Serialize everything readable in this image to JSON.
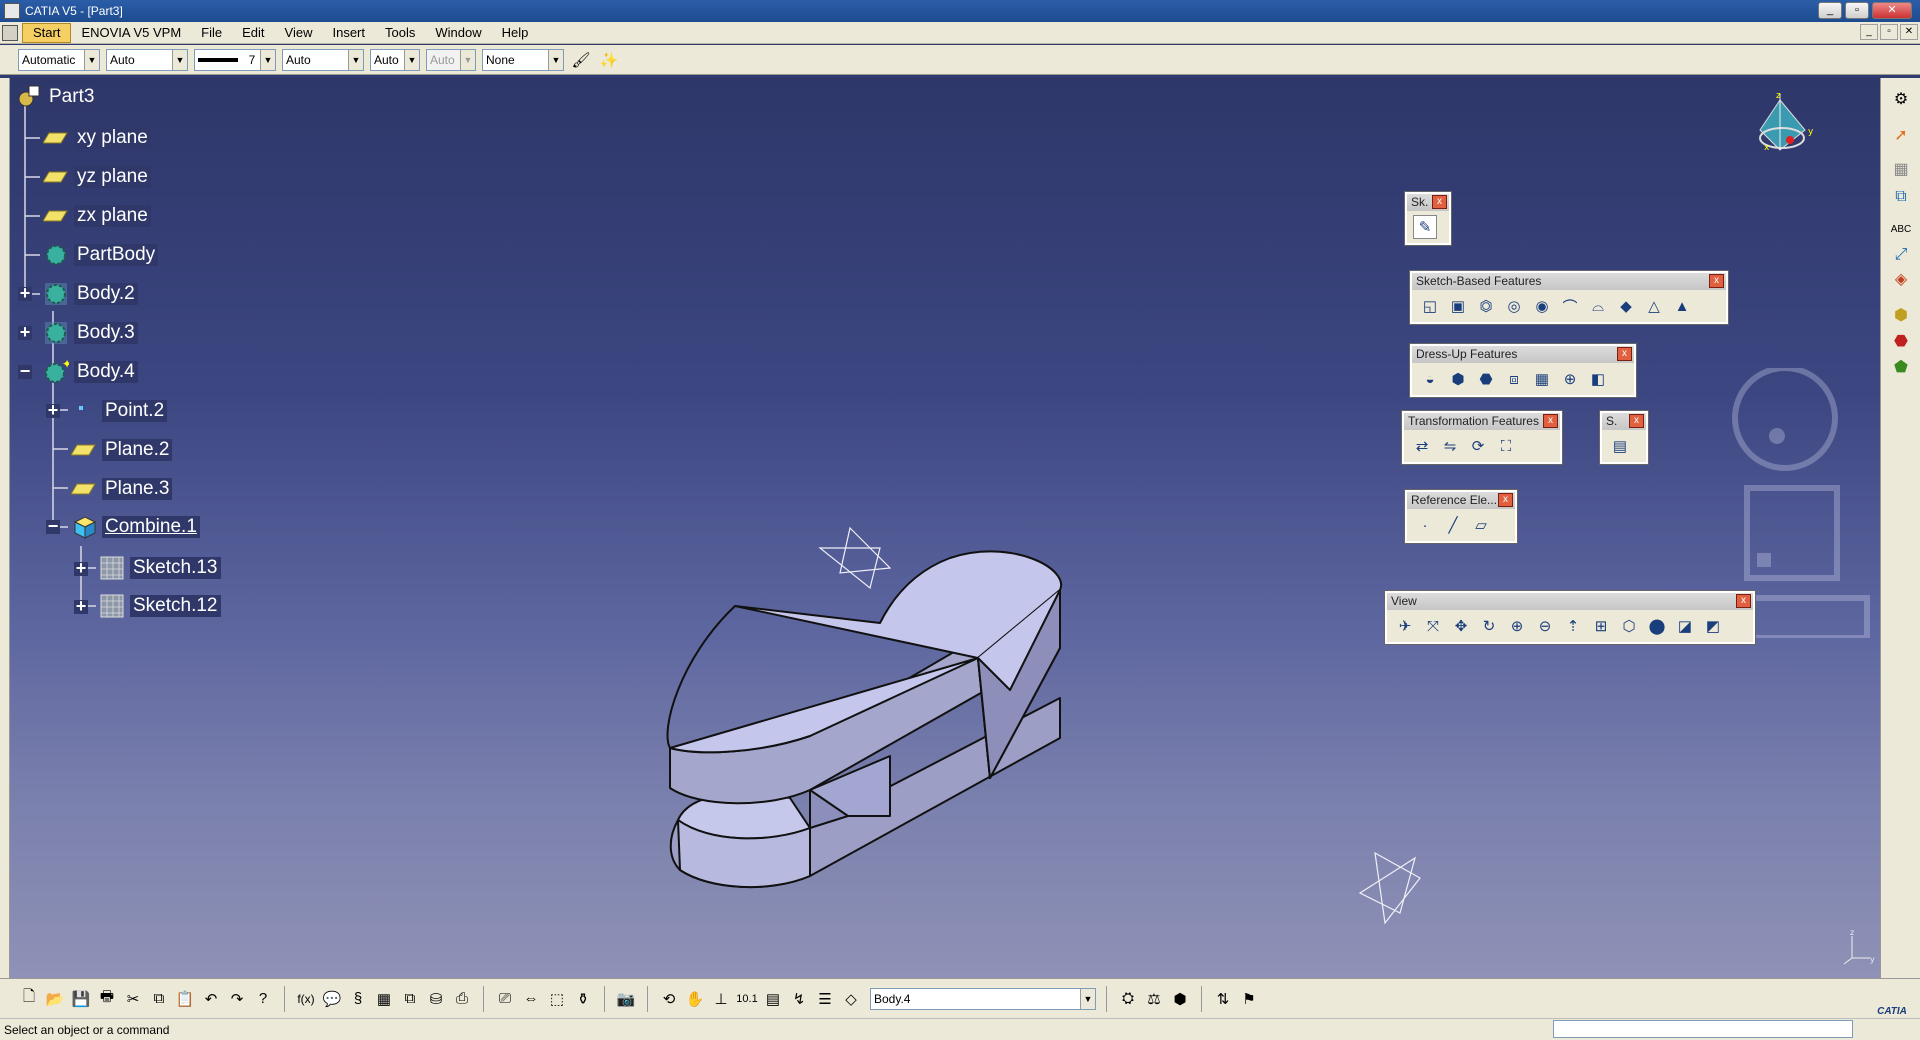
{
  "window": {
    "title": "CATIA V5 - [Part3]"
  },
  "menu": {
    "items": [
      "Start",
      "ENOVIA V5 VPM",
      "File",
      "Edit",
      "View",
      "Insert",
      "Tools",
      "Window",
      "Help"
    ]
  },
  "properties_toolbar": {
    "color": "Automatic",
    "transparency": "Auto",
    "linetype_weight": "7",
    "line_type": "Auto",
    "point_type": "Auto",
    "layer_disabled": "Auto",
    "layer": "None"
  },
  "spec_tree": {
    "root": "Part3",
    "nodes": [
      "xy plane",
      "yz plane",
      "zx plane",
      "PartBody",
      "Body.2",
      "Body.3",
      "Body.4",
      "Point.2",
      "Plane.2",
      "Plane.3",
      "Combine.1",
      "Sketch.13",
      "Sketch.12"
    ]
  },
  "toolbars": {
    "sketcher": "Sk.",
    "sketch_based": "Sketch-Based Features",
    "dress_up": "Dress-Up Features",
    "transformation": "Transformation Features",
    "surface": "S.",
    "reference": "Reference Ele...",
    "view": "View"
  },
  "bottom_toolbar": {
    "current_body": "Body.4"
  },
  "status": {
    "message": "Select an object or a command"
  },
  "icons": {
    "compass": "compass-icon",
    "catia_logo": "catia-logo-icon"
  }
}
